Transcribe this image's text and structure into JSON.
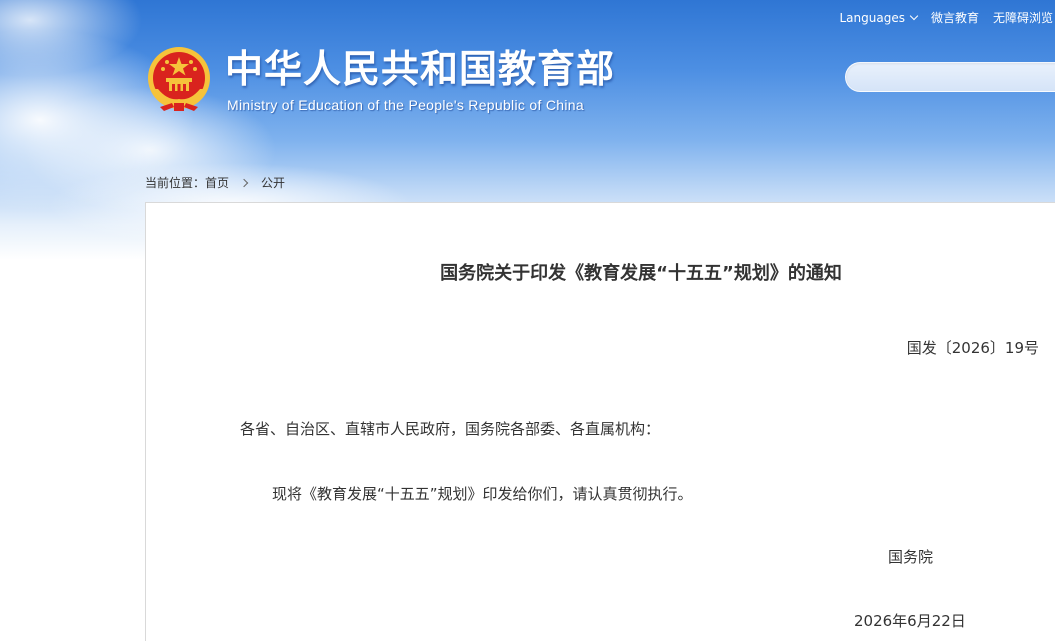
{
  "top_links": {
    "languages": "Languages",
    "weibo": "微言教育",
    "accessibility": "无障碍浏览"
  },
  "header": {
    "title_cn": "中华人民共和国教育部",
    "title_en": "Ministry of Education of the People's Republic of China",
    "emblem_icon": "national-emblem-icon",
    "search_placeholder": ""
  },
  "breadcrumb": {
    "prefix": "当前位置：",
    "home": "首页",
    "current": "公开"
  },
  "document": {
    "title": "国务院关于印发《教育发展“十五五”规划》的通知",
    "number": "国发〔2026〕19号",
    "addressee": "各省、自治区、直辖市人民政府，国务院各部委、各直属机构：",
    "body": "现将《教育发展“十五五”规划》印发给你们，请认真贯彻执行。",
    "signer": "国务院",
    "date": "2026年6月22日"
  },
  "colors": {
    "sky_top": "#2f76d4",
    "emblem_red": "#d9231e",
    "emblem_gold": "#f6c33b",
    "text": "#333333"
  }
}
